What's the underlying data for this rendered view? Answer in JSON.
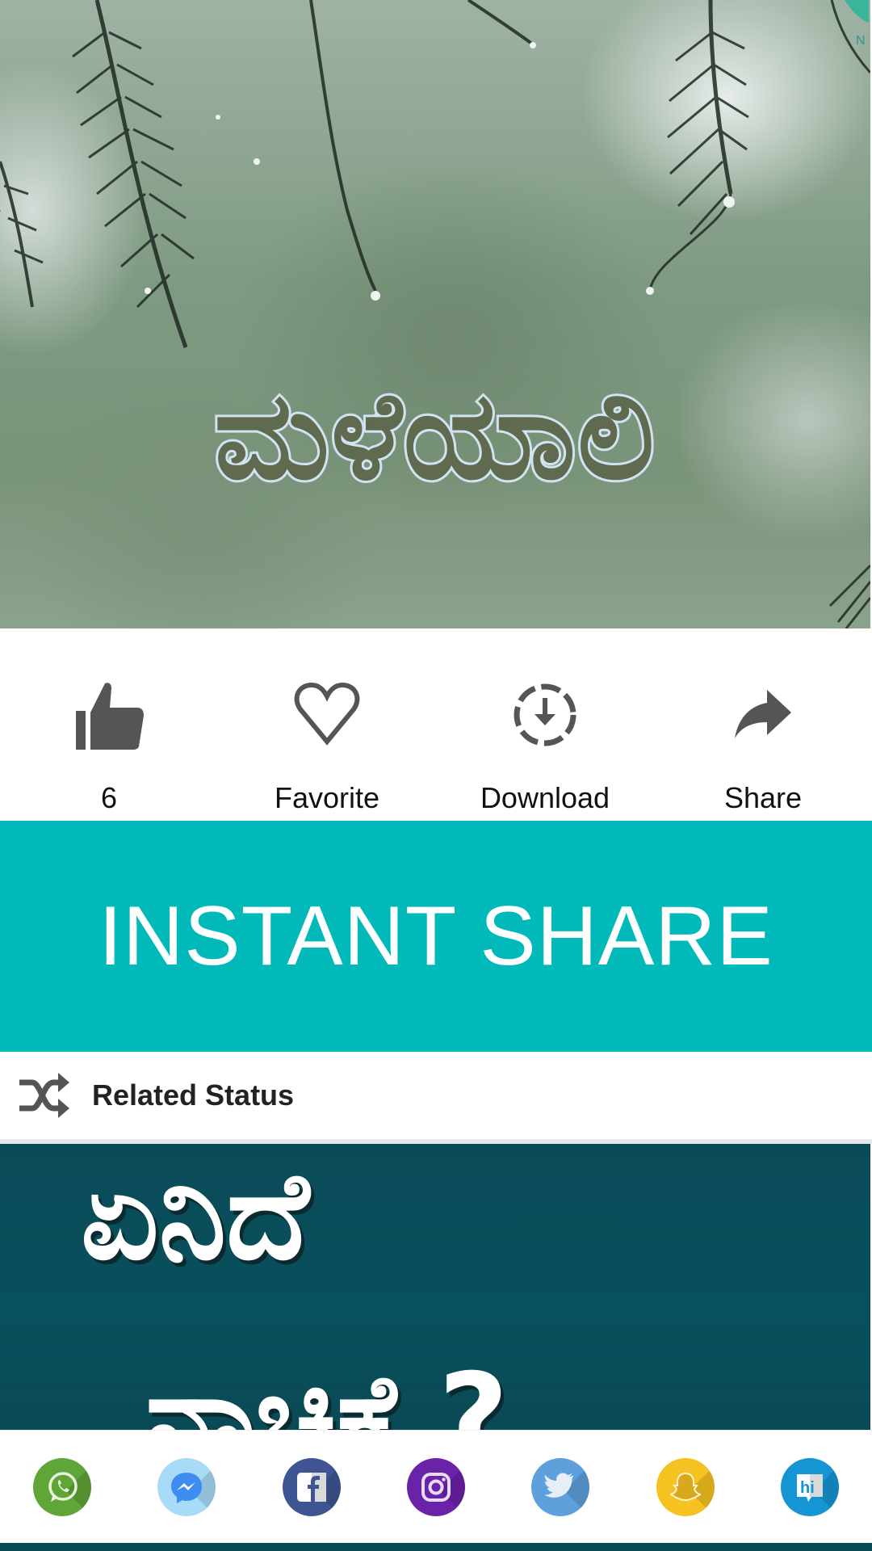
{
  "hero": {
    "title": "ಮಳೆಯಾಲಿ",
    "icon": "video-thumbnail"
  },
  "actions": [
    {
      "name": "like",
      "icon": "thumbs-up-icon",
      "label": "6"
    },
    {
      "name": "favorite",
      "icon": "heart-icon",
      "label": "Favorite"
    },
    {
      "name": "download",
      "icon": "download-circle-icon",
      "label": "Download"
    },
    {
      "name": "share",
      "icon": "share-arrow-icon",
      "label": "Share"
    }
  ],
  "instant_share": {
    "label": "INSTANT SHARE",
    "color": "#02b9b9"
  },
  "related": {
    "title": "Related Status",
    "icon": "shuffle-icon",
    "thumbnail": {
      "line1": "ಏನಿದೆ",
      "line2": "ನಾಚಿಕೆ ?"
    }
  },
  "share_bar": {
    "apps": [
      {
        "name": "WhatsApp",
        "icon": "whatsapp-icon",
        "color": "#5fa537"
      },
      {
        "name": "Messenger",
        "icon": "messenger-icon",
        "color": "#a8dbf8"
      },
      {
        "name": "Facebook",
        "icon": "facebook-icon",
        "color": "#3f5593"
      },
      {
        "name": "Instagram",
        "icon": "instagram-icon",
        "color": "#6a22a8"
      },
      {
        "name": "Twitter",
        "icon": "twitter-icon",
        "color": "#5ea0dc"
      },
      {
        "name": "Snapchat",
        "icon": "snapchat-icon",
        "color": "#f6c220"
      },
      {
        "name": "Hike",
        "icon": "hike-icon",
        "color": "#1595d3"
      }
    ]
  }
}
